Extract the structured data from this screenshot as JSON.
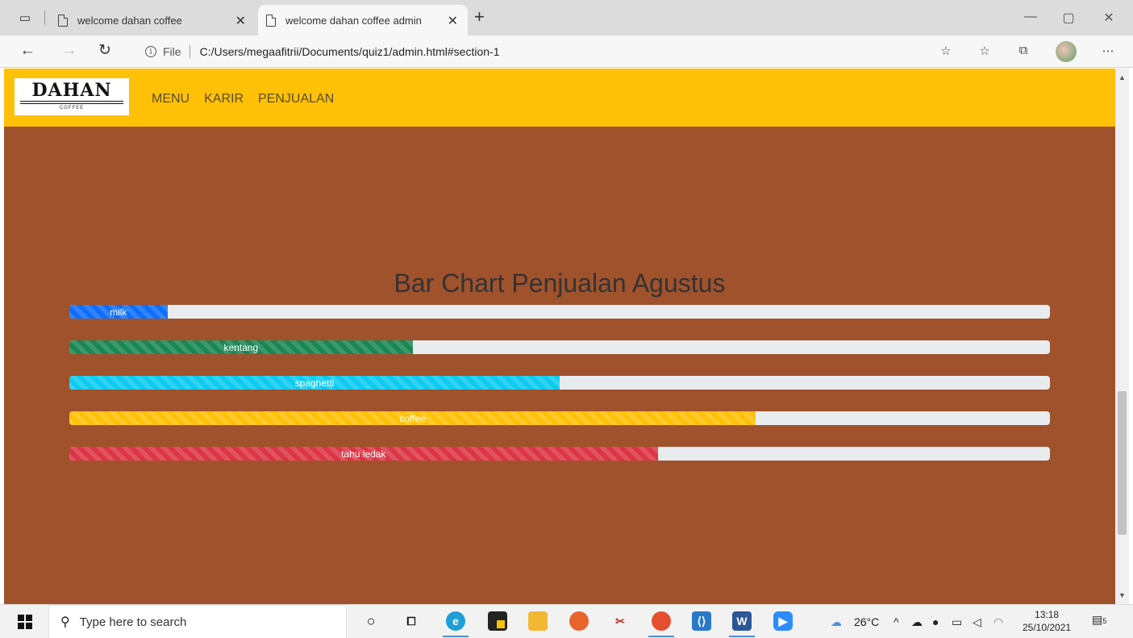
{
  "browser": {
    "tabs": [
      {
        "title": "welcome dahan coffee",
        "active": false
      },
      {
        "title": "welcome dahan coffee admin",
        "active": true
      }
    ],
    "address": {
      "scheme_label": "File",
      "url": "C:/Users/megaafitrii/Documents/quiz1/admin.html#section-1"
    }
  },
  "site": {
    "logo": {
      "brand": "DAHAN",
      "sub": "COFFEE"
    },
    "nav": [
      {
        "label": "MENU"
      },
      {
        "label": "KARIR"
      },
      {
        "label": "PENJUALAN"
      }
    ],
    "colors": {
      "navbar": "#ffc107",
      "background": "#a0522d",
      "track": "#e9ecef"
    }
  },
  "chart_data": {
    "type": "bar",
    "title": "Bar Chart Penjualan Agustus",
    "orientation": "horizontal",
    "ylim": [
      0,
      100
    ],
    "categories": [
      "milk",
      "kentang",
      "spaghetti",
      "coffee",
      "tahu ledak"
    ],
    "values": [
      10,
      35,
      50,
      70,
      60
    ],
    "colors": [
      "#0d6efd",
      "#198754",
      "#0dcaf0",
      "#ffc107",
      "#dc3545"
    ],
    "striped": true
  },
  "taskbar": {
    "search_placeholder": "Type here to search",
    "weather": "26°C",
    "time": "13:18",
    "date": "25/10/2021",
    "notifications": "5"
  }
}
